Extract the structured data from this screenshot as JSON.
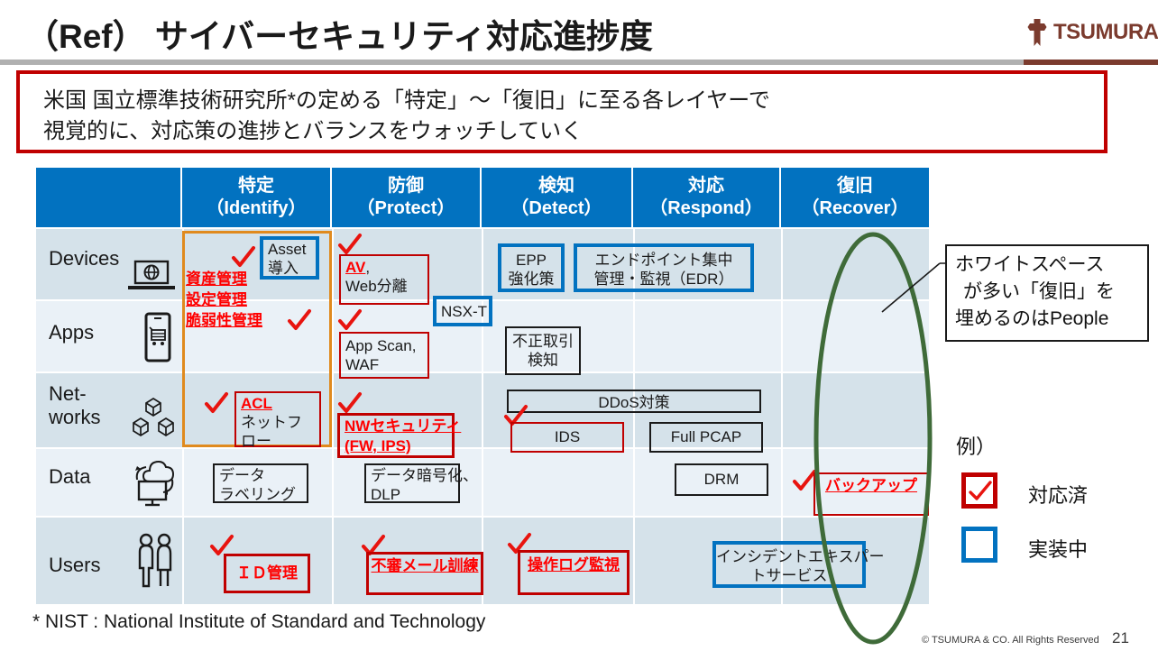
{
  "header": {
    "title": "（Ref） サイバーセキュリティ対応進捗度",
    "logo_text": "TSUMURA",
    "brand_color": "#7b3b2e"
  },
  "lead": {
    "line1": "米国 国立標準技術研究所*の定める「特定」〜「復旧」に至る各レイヤーで",
    "line2": "視覚的に、対応策の進捗とバランスをウォッチしていく",
    "border_color": "#c00000"
  },
  "table": {
    "header_color": "#0272c0",
    "columns": [
      {
        "jp": "",
        "en": ""
      },
      {
        "jp": "特定",
        "en": "（Identify）"
      },
      {
        "jp": "防御",
        "en": "（Protect）"
      },
      {
        "jp": "検知",
        "en": "（Detect）"
      },
      {
        "jp": "対応",
        "en": "（Respond）"
      },
      {
        "jp": "復旧",
        "en": "（Recover）"
      }
    ],
    "rows": [
      {
        "label": "Devices",
        "icon": "laptop-globe-icon"
      },
      {
        "label": "Apps",
        "icon": "mobile-app-icon"
      },
      {
        "label": "Net-\nworks",
        "icon": "network-cubes-icon"
      },
      {
        "label": "Data",
        "icon": "cloud-monitor-icon"
      },
      {
        "label": "Users",
        "icon": "people-icon"
      }
    ]
  },
  "items": {
    "asset": "Asset\n導入",
    "identify_red_list": [
      "資産管理",
      "設定管理",
      "脆弱性管理"
    ],
    "acl": "ACL",
    "acl_sub": "ネットフ\nロー",
    "id_kanri": "ＩＤ管理",
    "av": "AV",
    "av_rest": ",\nWeb分離",
    "nsxt": "NSX-T",
    "app_scan": "App Scan,\nWAF",
    "nw_sec_l1": "NWセキュリティ",
    "nw_sec_l2": "(FW, IPS)",
    "data_enc": "データ暗号化、\nDLP",
    "mail_drill": "不審メール訓練",
    "epp": "EPP\n強化策",
    "fraud_detect": "不正取引\n検知",
    "ddos": "DDoS対策",
    "ids": "IDS",
    "data_label": "データ\nラベリング",
    "oplog": "操作ログ監視",
    "edr": "エンドポイント集中\n管理・監視（EDR）",
    "full_pcap": "Full PCAP",
    "drm": "DRM",
    "incident": "インシデントエキスパー\nトサービス",
    "backup": "バックアップ"
  },
  "callout": {
    "line1": "ホワイトスペース",
    "line2": "が多い「復旧」を",
    "line3": "埋めるのはPeople"
  },
  "legend": {
    "title": "例）",
    "done_label": "対応済",
    "inprogress_label": "実装中",
    "done_color": "#c00000",
    "inprogress_color": "#0272c0"
  },
  "footer": {
    "footnote": "* NIST : National Institute of Standard and Technology",
    "copyright": "© TSUMURA & CO. All Rights Reserved",
    "page_number": "21"
  }
}
